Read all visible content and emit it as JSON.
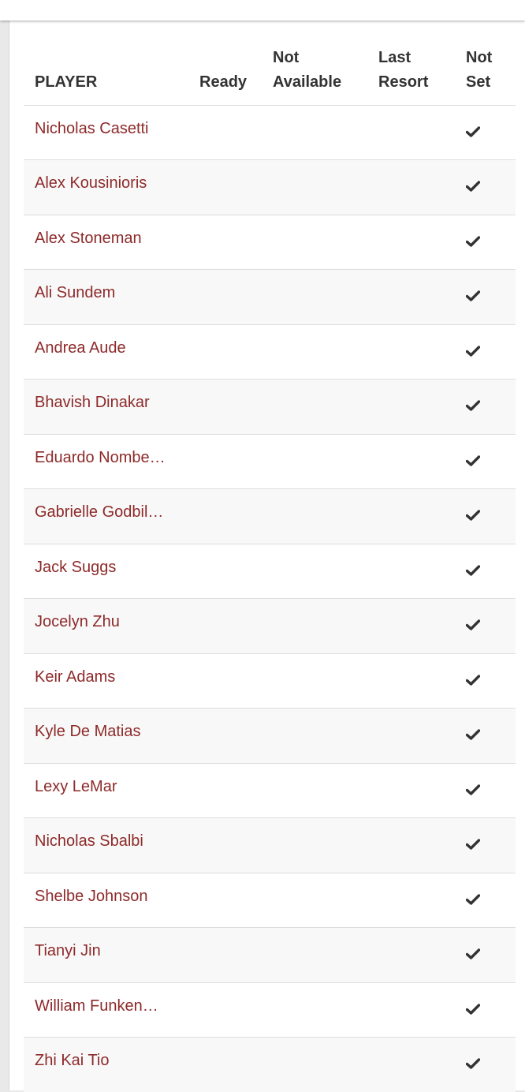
{
  "header": {
    "player": "PLAYER",
    "ready": "Ready",
    "not_available_line1": "Not",
    "not_available_line2": "Available",
    "last_resort_line1": "Last",
    "last_resort_line2": "Resort",
    "not_set_line1": "Not",
    "not_set_line2": "Set"
  },
  "players": [
    {
      "name": "Nicholas Casetti",
      "status": "Not Set"
    },
    {
      "name": "Alex Kousinioris",
      "status": "Not Set"
    },
    {
      "name": "Alex Stoneman",
      "status": "Not Set"
    },
    {
      "name": "Ali Sundem",
      "status": "Not Set"
    },
    {
      "name": "Andrea Aude",
      "status": "Not Set"
    },
    {
      "name": "Bhavish Dinakar",
      "status": "Not Set"
    },
    {
      "name": "Eduardo Nombe…",
      "status": "Not Set"
    },
    {
      "name": "Gabrielle Godbil…",
      "status": "Not Set"
    },
    {
      "name": "Jack Suggs",
      "status": "Not Set"
    },
    {
      "name": "Jocelyn Zhu",
      "status": "Not Set"
    },
    {
      "name": "Keir Adams",
      "status": "Not Set"
    },
    {
      "name": "Kyle De Matias",
      "status": "Not Set"
    },
    {
      "name": "Lexy LeMar",
      "status": "Not Set"
    },
    {
      "name": "Nicholas Sbalbi",
      "status": "Not Set"
    },
    {
      "name": "Shelbe Johnson",
      "status": "Not Set"
    },
    {
      "name": "Tianyi Jin",
      "status": "Not Set"
    },
    {
      "name": "William Funken…",
      "status": "Not Set"
    },
    {
      "name": "Zhi Kai Tio",
      "status": "Not Set"
    }
  ],
  "icons": {
    "check": "check-icon"
  },
  "colors": {
    "player_link": "#8e2a2a",
    "header_text": "#333333",
    "check": "#333333"
  }
}
